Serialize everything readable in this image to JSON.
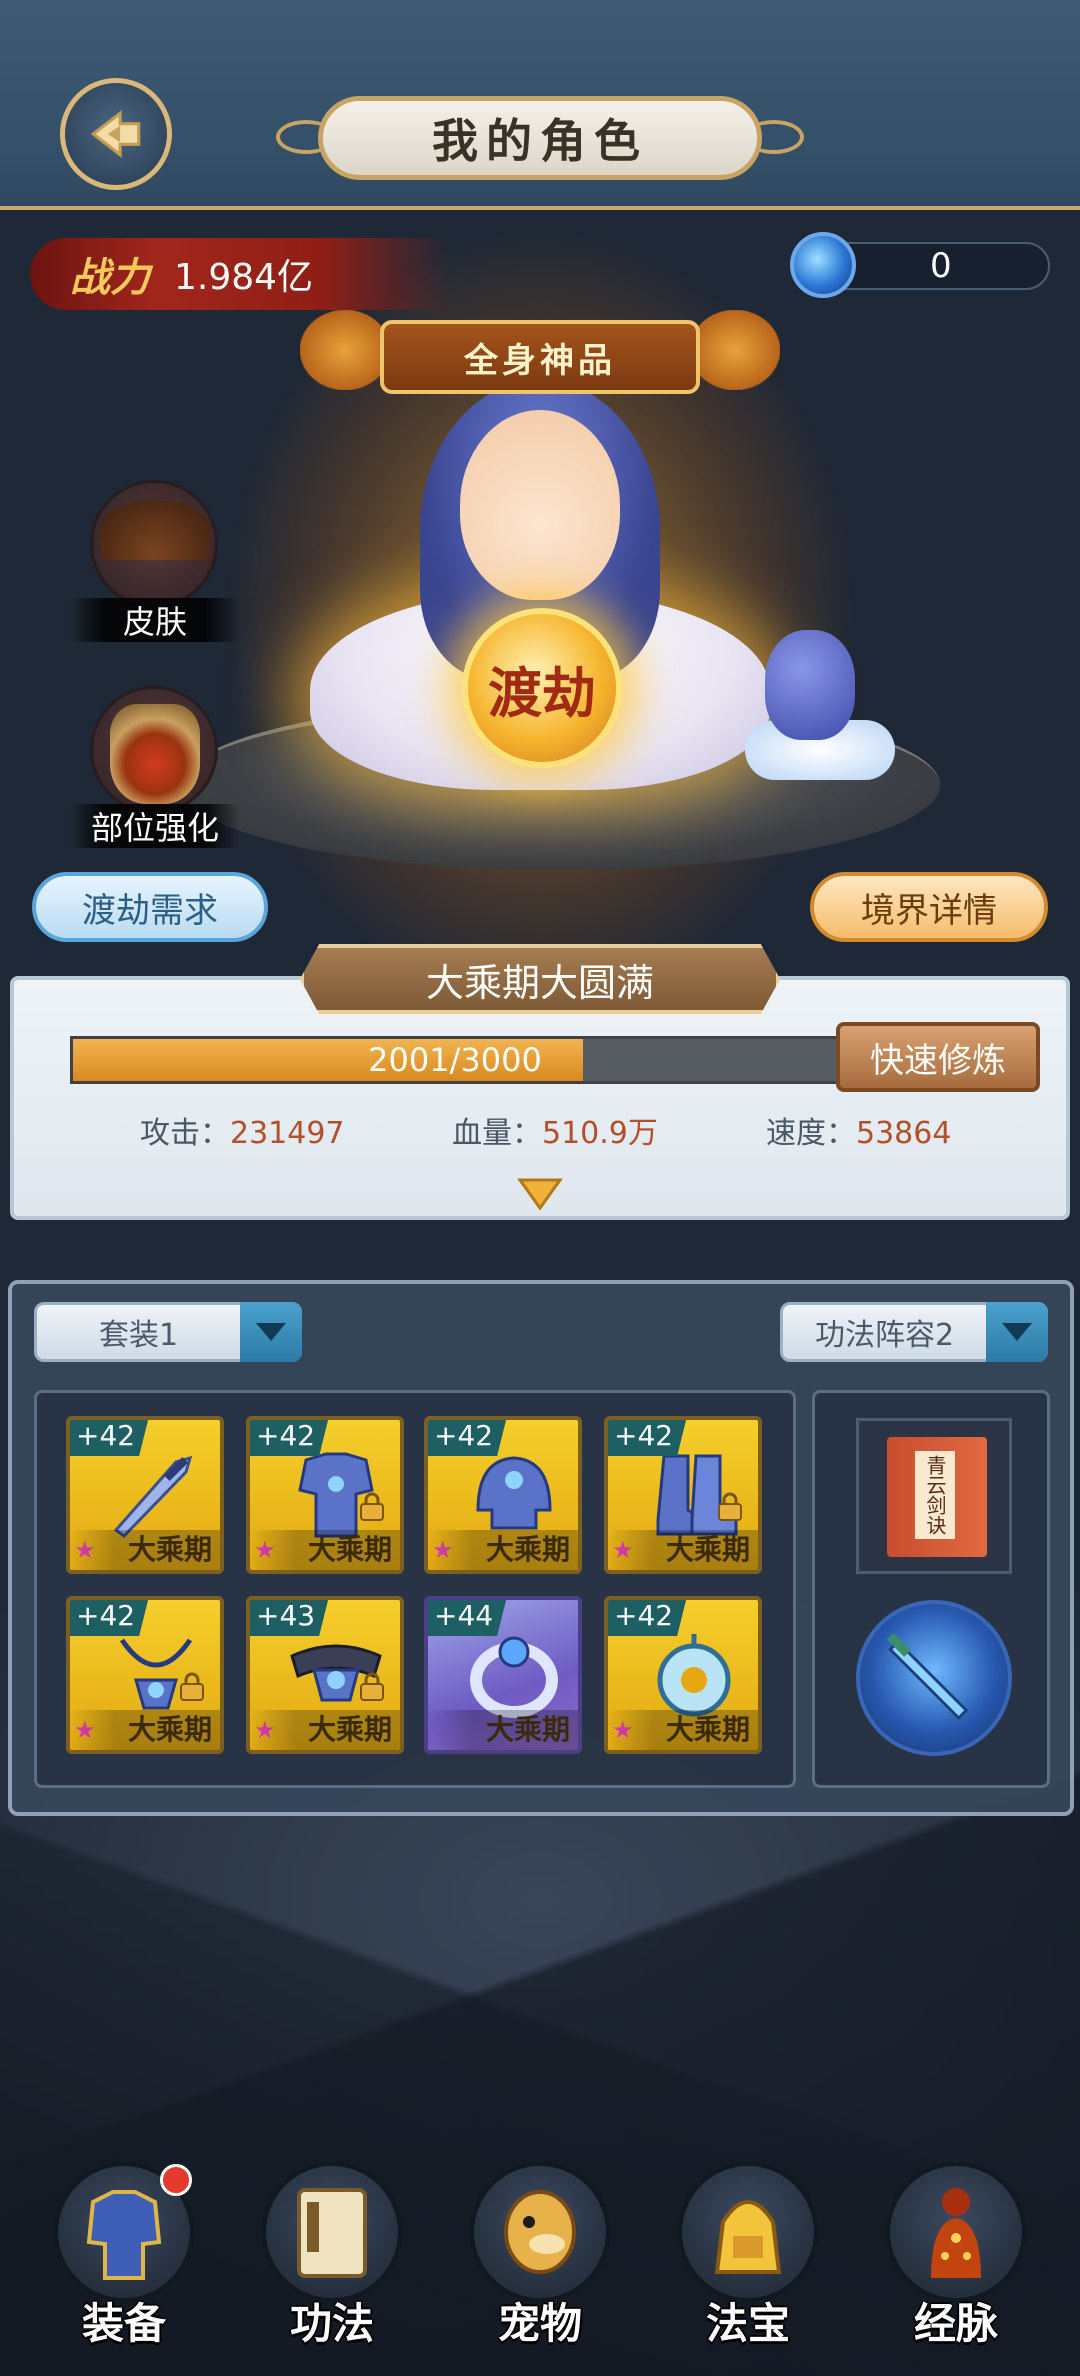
{
  "header": {
    "title": "我的角色",
    "back_icon": "back-arrow-icon"
  },
  "power": {
    "label": "战力",
    "value": "1.984亿"
  },
  "currency": {
    "icon": "spirit-orb-icon",
    "value": "0"
  },
  "character": {
    "banner": "全身神品",
    "center_button": "渡劫"
  },
  "side_buttons": {
    "skin": "皮肤",
    "part_enhance": "部位强化"
  },
  "pills": {
    "tribulation_req": "渡劫需求",
    "realm_detail": "境界详情"
  },
  "realm": {
    "name": "大乘期大圆满",
    "exp_text": "2001/3000",
    "exp_current": 2001,
    "exp_max": 3000,
    "quick_train": "快速修炼"
  },
  "stats": {
    "attack_label": "攻击：",
    "attack_value": "231497",
    "hp_label": "血量：",
    "hp_value": "510.9万",
    "speed_label": "速度：",
    "speed_value": "53864"
  },
  "equipment": {
    "set_select": "套装1",
    "skill_select": "功法阵容2",
    "slots": [
      {
        "level": "+42",
        "name": "大乘期",
        "icon": "sword-icon",
        "locked": false
      },
      {
        "level": "+42",
        "name": "大乘期",
        "icon": "armor-icon",
        "locked": true
      },
      {
        "level": "+42",
        "name": "大乘期",
        "icon": "helmet-icon",
        "locked": false
      },
      {
        "level": "+42",
        "name": "大乘期",
        "icon": "boots-icon",
        "locked": true
      },
      {
        "level": "+42",
        "name": "大乘期",
        "icon": "necklace-icon",
        "locked": true
      },
      {
        "level": "+43",
        "name": "大乘期",
        "icon": "belt-icon",
        "locked": true
      },
      {
        "level": "+44",
        "name": "大乘期",
        "icon": "ring-icon",
        "locked": false
      },
      {
        "level": "+42",
        "name": "大乘期",
        "icon": "jade-pendant-icon",
        "locked": false
      }
    ],
    "book_title": "青云剑诀"
  },
  "nav": {
    "items": [
      {
        "label": "装备",
        "icon": "equipment-icon",
        "badge": true
      },
      {
        "label": "功法",
        "icon": "skill-book-icon",
        "badge": false
      },
      {
        "label": "宠物",
        "icon": "pet-icon",
        "badge": false
      },
      {
        "label": "法宝",
        "icon": "treasure-icon",
        "badge": false
      },
      {
        "label": "经脉",
        "icon": "meridian-icon",
        "badge": false
      }
    ]
  },
  "colors": {
    "accent_gold": "#c9a96a",
    "exp_fill": "#e39a2f",
    "slot_gold": "#f0c021",
    "slot_purple": "#8f68c7"
  }
}
